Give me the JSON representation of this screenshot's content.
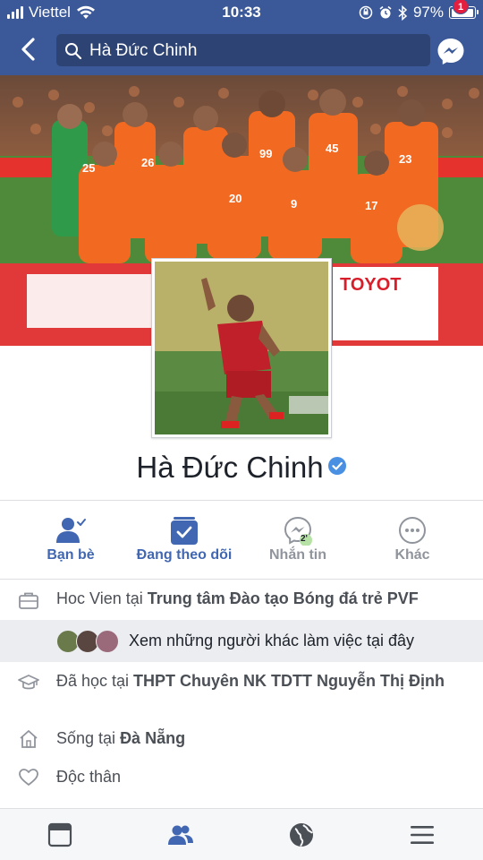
{
  "status_bar": {
    "carrier": "Viettel",
    "time": "10:33",
    "battery": "97%"
  },
  "search": {
    "query": "Hà Đức Chinh"
  },
  "messenger": {
    "badge_count": "1"
  },
  "profile": {
    "name": "Hà Đức Chinh",
    "verified": true
  },
  "actions": [
    {
      "label": "Bạn bè",
      "icon": "friends-icon"
    },
    {
      "label": "Đang theo dõi",
      "icon": "following-check-icon"
    },
    {
      "label": "Nhắn tin",
      "icon": "messenger-icon",
      "badge": "2'"
    },
    {
      "label": "Khác",
      "icon": "more-icon"
    }
  ],
  "about": {
    "work_prefix": "Hoc Vien tại ",
    "work_place": "Trung tâm Đào tạo Bóng đá trẻ PVF",
    "coworkers_text": "Xem những người khác làm việc tại đây",
    "edu_prefix": "Đã học tại ",
    "edu_place": "THPT Chuyên NK TDTT Nguyễn Thị Định",
    "lives_prefix": "Sống tại ",
    "lives_place": "Đà Nẵng",
    "relationship": "Độc thân"
  },
  "colors": {
    "facebook_blue": "#3b5998",
    "link_blue": "#4267b2",
    "badge_red": "#e41e3f",
    "jersey_orange": "#f26a21"
  }
}
